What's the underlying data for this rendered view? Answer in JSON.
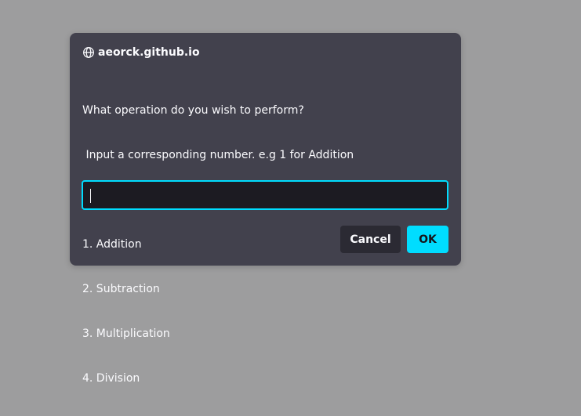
{
  "dialog": {
    "origin": "aeorck.github.io",
    "origin_icon": "globe-icon",
    "message_lines": [
      "What operation do you wish to perform?",
      " Input a corresponding number. e.g 1 for Addition",
      "",
      "1. Addition",
      "2. Subtraction",
      "3. Multiplication",
      "4. Division"
    ],
    "input_value": "",
    "cancel_label": "Cancel",
    "ok_label": "OK"
  },
  "colors": {
    "backdrop": "#9d9d9e",
    "dialog_bg": "#42414d",
    "input_bg": "#1c1b22",
    "accent": "#00ddff",
    "cancel_bg": "#2b2a33",
    "text": "#fbfbfe"
  }
}
